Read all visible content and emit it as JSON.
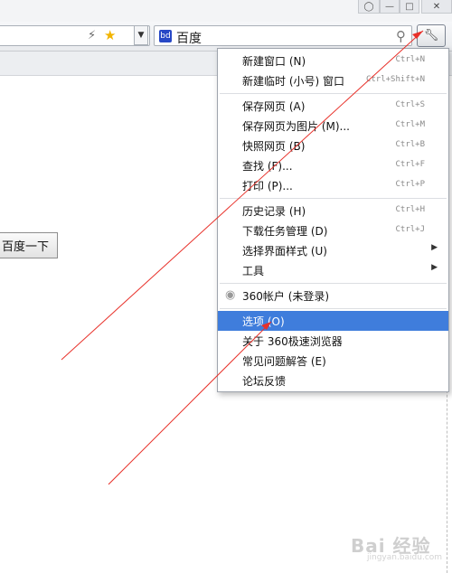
{
  "toolbar": {
    "search_engine_name": "百度",
    "search_engine_logo": "bd"
  },
  "page": {
    "search_button_label": "百度一下"
  },
  "menu": {
    "items": [
      {
        "label": "新建窗口 (N)",
        "shortcut": "Ctrl+N"
      },
      {
        "label": "新建临时 (小号) 窗口",
        "shortcut": "Ctrl+Shift+N"
      },
      {
        "label": "保存网页 (A)",
        "shortcut": "Ctrl+S"
      },
      {
        "label": "保存网页为图片 (M)...",
        "shortcut": "Ctrl+M"
      },
      {
        "label": "快照网页 (B)",
        "shortcut": "Ctrl+B"
      },
      {
        "label": "查找 (F)...",
        "shortcut": "Ctrl+F"
      },
      {
        "label": "打印 (P)...",
        "shortcut": "Ctrl+P"
      },
      {
        "label": "历史记录 (H)",
        "shortcut": "Ctrl+H"
      },
      {
        "label": "下载任务管理 (D)",
        "shortcut": "Ctrl+J"
      },
      {
        "label": "选择界面样式 (U)",
        "shortcut": ""
      },
      {
        "label": "工具",
        "shortcut": ""
      },
      {
        "label": "360帐户 (未登录)",
        "shortcut": ""
      },
      {
        "label": "选项 (O)",
        "shortcut": ""
      },
      {
        "label": "关于 360极速浏览器",
        "shortcut": ""
      },
      {
        "label": "常见问题解答 (E)",
        "shortcut": ""
      },
      {
        "label": "论坛反馈",
        "shortcut": ""
      }
    ]
  },
  "watermark": {
    "brand": "Bai 经验",
    "url": "jingyan.baidu.com"
  },
  "colors": {
    "highlight": "#3f7ddc",
    "annotation": "#e8312a"
  }
}
